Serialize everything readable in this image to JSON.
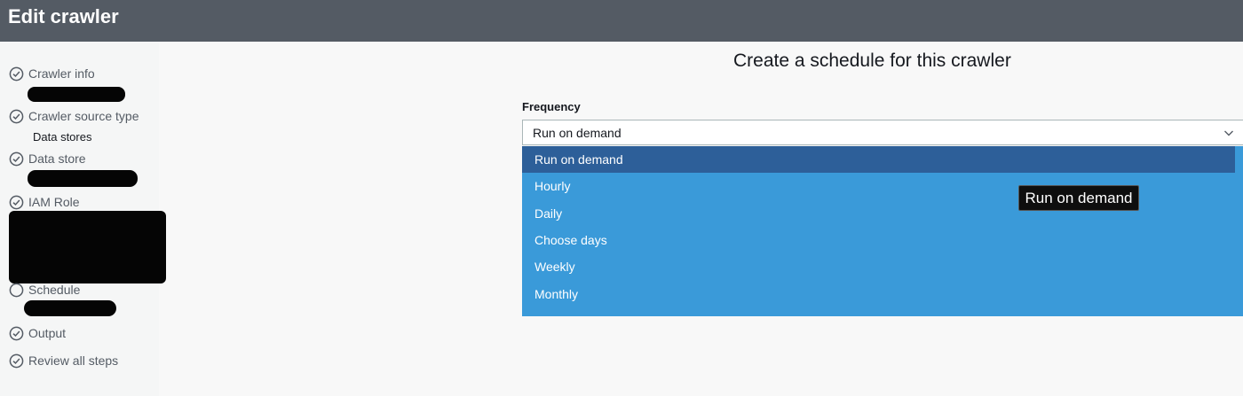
{
  "header": {
    "title": "Edit crawler"
  },
  "sidebar": {
    "steps": [
      {
        "label": "Crawler info",
        "icon": "check-circle-icon"
      },
      {
        "label": "Crawler source type",
        "icon": "check-circle-icon",
        "sublabel": "Data stores"
      },
      {
        "label": "Data store",
        "icon": "check-circle-icon"
      },
      {
        "label": "IAM Role",
        "icon": "check-circle-icon"
      },
      {
        "label": "Schedule",
        "icon": "empty-circle-icon"
      },
      {
        "label": "Output",
        "icon": "check-circle-icon"
      },
      {
        "label": "Review all steps",
        "icon": "check-circle-icon"
      }
    ]
  },
  "main": {
    "title": "Create a schedule for this crawler",
    "frequency": {
      "label": "Frequency",
      "value": "Run on demand",
      "options": [
        "Run on demand",
        "Hourly",
        "Daily",
        "Choose days",
        "Weekly",
        "Monthly"
      ],
      "selected_index": 0
    },
    "tooltip": "Run on demand"
  },
  "colors": {
    "header_bg": "#545b64",
    "dropdown_bg": "#3a9ad9",
    "selected_option_bg": "#2d5f99"
  }
}
